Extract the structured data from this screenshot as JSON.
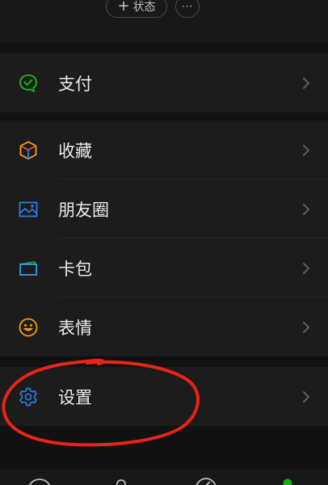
{
  "header": {
    "status_label": "状态",
    "status_plus": "+",
    "more_label": "···"
  },
  "groups": [
    {
      "items": [
        {
          "label": "支付",
          "icon": "wechat-pay-icon",
          "color": "#1AAD19"
        }
      ]
    },
    {
      "items": [
        {
          "label": "收藏",
          "icon": "favorites-cube-icon",
          "color": "#F5A623"
        },
        {
          "label": "朋友圈",
          "icon": "moments-picture-icon",
          "color": "#2A7BE4"
        },
        {
          "label": "卡包",
          "icon": "card-wallet-icon",
          "color": "#2A9FE4"
        },
        {
          "label": "表情",
          "icon": "sticker-smile-icon",
          "color": "#F39C12"
        }
      ]
    },
    {
      "items": [
        {
          "label": "设置",
          "icon": "settings-gear-icon",
          "color": "#2A7BE4"
        }
      ]
    }
  ],
  "annotation": {
    "shape": "hand-drawn-circle",
    "color": "#E8231A",
    "target": "设置"
  }
}
